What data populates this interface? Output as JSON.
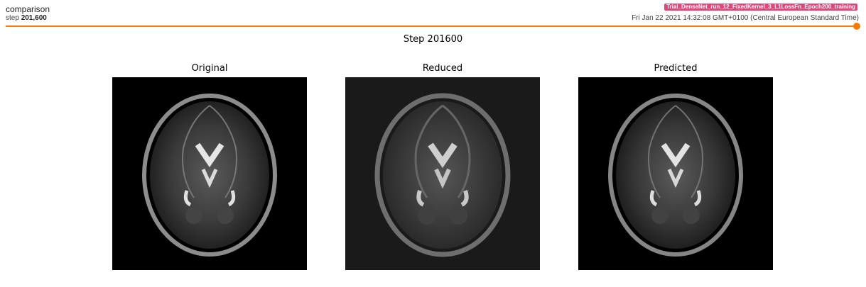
{
  "header": {
    "tag": "comparison",
    "step_prefix": "step",
    "step_value": "201,600",
    "run_name": "Trial_DenseNet_run_12_FixedKernel_3_L1LossFn_Epoch200_training",
    "timestamp": "Fri Jan 22 2021 14:32:08 GMT+0100 (Central European Standard Time)",
    "accent_color": "#f57c00",
    "badge_color": "#e0457b"
  },
  "figure": {
    "title": "Step 201600",
    "panels": [
      {
        "title": "Original",
        "background": "#000000"
      },
      {
        "title": "Reduced",
        "background": "#1a1a1a"
      },
      {
        "title": "Predicted",
        "background": "#000000"
      }
    ]
  }
}
